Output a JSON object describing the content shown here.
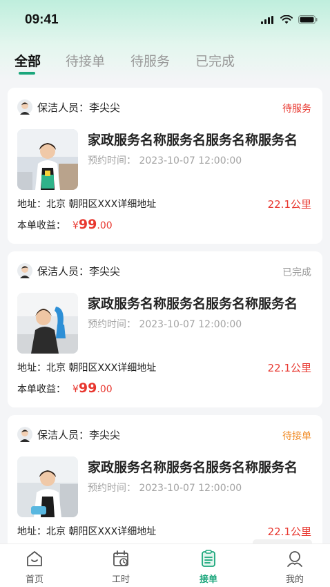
{
  "status_bar": {
    "time": "09:41"
  },
  "tabs": [
    {
      "label": "全部"
    },
    {
      "label": "待接单"
    },
    {
      "label": "待服务"
    },
    {
      "label": "已完成"
    }
  ],
  "orders": [
    {
      "worker_label": "保洁人员：",
      "worker_name": "李尖尖",
      "status": "待服务",
      "status_color": "#e8372f",
      "service_name": "家政服务名称服务名服务名称服务名",
      "time_label": "预约时间：",
      "time_value": "2023-10-07 12:00:00",
      "address": "地址：北京 朝阳区XXX详细地址",
      "distance": "22.1公里",
      "income_label": "本单收益：",
      "income_symbol": "¥",
      "income_int": "99",
      "income_dec": ".00"
    },
    {
      "worker_label": "保洁人员：",
      "worker_name": "李尖尖",
      "status": "已完成",
      "status_color": "#9a9a9a",
      "service_name": "家政服务名称服务名服务名称服务名",
      "time_label": "预约时间：",
      "time_value": "2023-10-07 12:00:00",
      "address": "地址：北京 朝阳区XXX详细地址",
      "distance": "22.1公里",
      "income_label": "本单收益：",
      "income_symbol": "¥",
      "income_int": "99",
      "income_dec": ".00"
    },
    {
      "worker_label": "保洁人员：",
      "worker_name": "李尖尖",
      "status": "待接单",
      "status_color": "#f08a24",
      "service_name": "家政服务名称服务名服务名称服务名",
      "time_label": "预约时间：",
      "time_value": "2023-10-07 12:00:00",
      "address": "地址：北京 朝阳区XXX详细地址",
      "distance": "22.1公里"
    }
  ],
  "tabbar": [
    {
      "label": "首页",
      "icon": "home-icon"
    },
    {
      "label": "工时",
      "icon": "calendar-clock-icon"
    },
    {
      "label": "接单",
      "icon": "order-list-icon"
    },
    {
      "label": "我的",
      "icon": "user-icon"
    }
  ],
  "colors": {
    "accent": "#1aa67b",
    "price": "#e8372f"
  }
}
